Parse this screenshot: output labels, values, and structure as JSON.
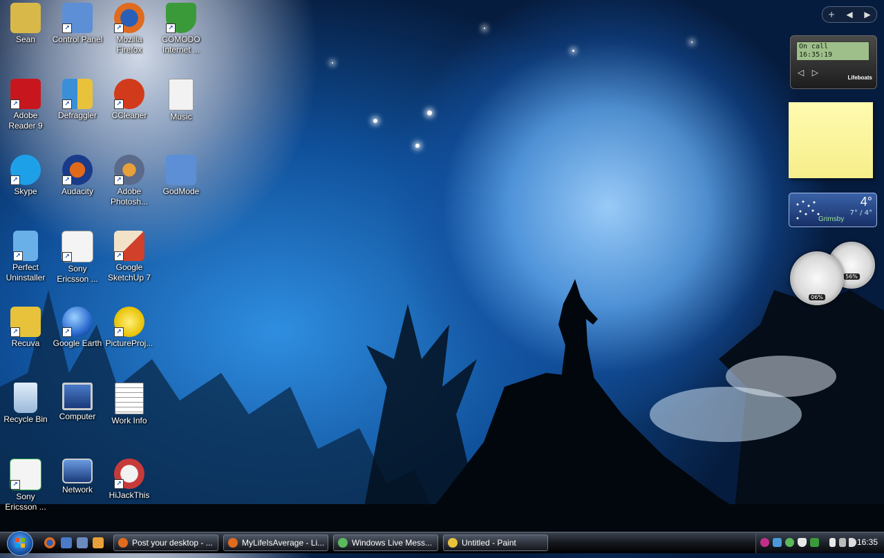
{
  "desktop": {
    "icons": [
      {
        "label": "Sean",
        "color": "#d9b84a"
      },
      {
        "label": "Control Panel",
        "color": "#5c8fd6"
      },
      {
        "label": "Mozilla Firefox",
        "color": "#e06a1e"
      },
      {
        "label": "COMODO Internet ...",
        "color": "#3a9a3a"
      },
      {
        "label": "Adobe Reader 9",
        "color": "#c8161e"
      },
      {
        "label": "Defraggler",
        "color": "#3b8fd8"
      },
      {
        "label": "CCleaner",
        "color": "#d23a1c"
      },
      {
        "label": "Music",
        "color": "#f2f2f2"
      },
      {
        "label": "Skype",
        "color": "#1ea0e8"
      },
      {
        "label": "Audacity",
        "color": "#e0691a"
      },
      {
        "label": "Adobe Photosh...",
        "color": "#5a6a8a"
      },
      {
        "label": "GodMode",
        "color": "#5c8fd6"
      },
      {
        "label": "Perfect Uninstaller",
        "color": "#6ab0e8"
      },
      {
        "label": "Sony Ericsson ...",
        "color": "#3bb14a"
      },
      {
        "label": "Google SketchUp 7",
        "color": "#d0402a"
      },
      {
        "label": "Recuva",
        "color": "#e8c23a"
      },
      {
        "label": "Google Earth",
        "color": "#2a6ad0"
      },
      {
        "label": "PictureProj...",
        "color": "#e8c000"
      },
      {
        "label": "Recycle Bin",
        "color": "#c0d8ee"
      },
      {
        "label": "Computer",
        "color": "#4a7ac8"
      },
      {
        "label": "Work Info",
        "color": "#e8e8e8"
      },
      {
        "label": "Sony Ericsson ...",
        "color": "#2aa84a"
      },
      {
        "label": "Network",
        "color": "#4a7ac8"
      },
      {
        "label": "HiJackThis",
        "color": "#c83a3a"
      }
    ]
  },
  "sidebar": {
    "controls": [
      "+",
      "◀",
      "▶"
    ],
    "lifeboat": {
      "line1": "On call",
      "line2": "16:35:19",
      "prev": "◁",
      "next": "▷",
      "brand": "Lifeboats"
    },
    "weather": {
      "temp": "4°",
      "range": "7° / 4°",
      "city": "Grimsby"
    },
    "gauges": {
      "cpu": "06%",
      "memory": "56%"
    }
  },
  "taskbar": {
    "buttons": [
      {
        "label": "Post your desktop - ...",
        "color": "#e06a1e"
      },
      {
        "label": "MyLifeIsAverage - Li...",
        "color": "#e06a1e"
      },
      {
        "label": "Windows Live Mess...",
        "color": "#5cb85c"
      },
      {
        "label": "Untitled - Paint",
        "color": "#e8c23a"
      }
    ],
    "clock": "16:35"
  }
}
